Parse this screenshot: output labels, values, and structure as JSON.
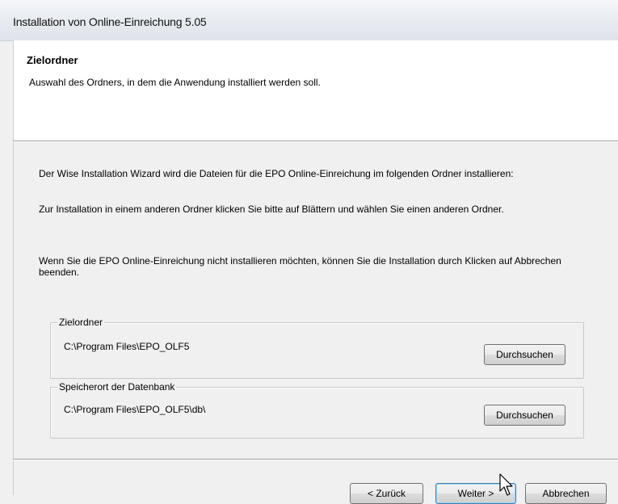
{
  "window": {
    "title": "Installation von Online-Einreichung 5.05"
  },
  "header": {
    "title": "Zielordner",
    "subtitle": "Auswahl des Ordners, in dem die Anwendung installiert werden soll."
  },
  "body": {
    "paragraph1": "Der Wise Installation Wizard wird die Dateien für die EPO Online-Einreichung im folgenden Ordner installieren:",
    "paragraph2": "Zur Installation in einem anderen Ordner klicken Sie bitte auf Blättern und wählen Sie einen anderen Ordner.",
    "paragraph3": "Wenn Sie die EPO Online-Einreichung nicht installieren möchten, können Sie die Installation durch Klicken auf Abbrechen beenden."
  },
  "target_folder": {
    "legend": "Zielordner",
    "path": "C:\\Program Files\\EPO_OLF5",
    "browse_label": "Durchsuchen"
  },
  "database_location": {
    "legend": "Speicherort der Datenbank",
    "path": "C:\\Program Files\\EPO_OLF5\\db\\",
    "browse_label": "Durchsuchen"
  },
  "footer": {
    "back_label": "< Zurück",
    "next_label": "Weiter >",
    "cancel_label": "Abbrechen"
  }
}
